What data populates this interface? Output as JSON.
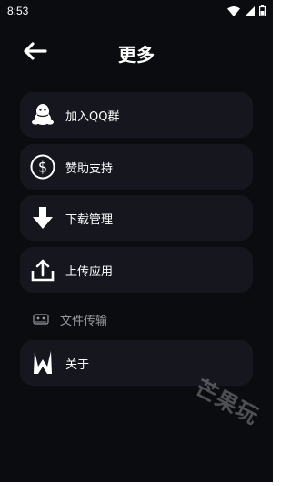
{
  "status_bar": {
    "time": "8:53",
    "icons": [
      "wifi-icon",
      "signal-icon",
      "battery-icon"
    ]
  },
  "header": {
    "back_icon": "arrow-left-icon",
    "title": "更多"
  },
  "menu": {
    "items": [
      {
        "label": "加入QQ群",
        "icon": "qq-penguin-icon"
      },
      {
        "label": "赞助支持",
        "icon": "dollar-icon"
      },
      {
        "label": "下载管理",
        "icon": "download-arrow-icon"
      },
      {
        "label": "上传应用",
        "icon": "upload-icon"
      },
      {
        "label": "文件传输",
        "icon": "file-transfer-icon"
      },
      {
        "label": "关于",
        "icon": "app-logo-icon"
      }
    ]
  },
  "watermark": {
    "text": "芒果玩"
  },
  "colors": {
    "background": "#0b0c10",
    "card": "#15161e",
    "text": "#ffffff",
    "muted_text": "#9a9aa2"
  }
}
